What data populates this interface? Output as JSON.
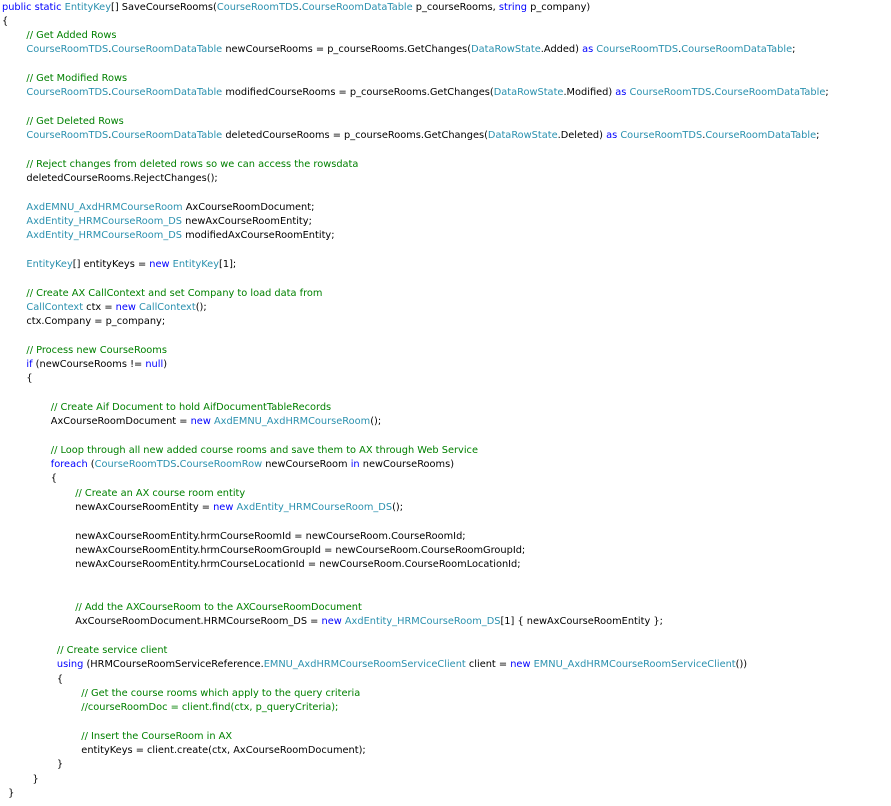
{
  "code_view": {
    "language": "csharp",
    "colors": {
      "keyword": "#0000ff",
      "type": "#2b91af",
      "comment": "#008000",
      "plain": "#000000",
      "background": "#ffffff"
    },
    "lines": [
      {
        "indent": 0,
        "tokens": [
          [
            "kw",
            "public"
          ],
          [
            "p",
            " "
          ],
          [
            "kw",
            "static"
          ],
          [
            "p",
            " "
          ],
          [
            "type",
            "EntityKey"
          ],
          [
            "p",
            "[] SaveCourseRooms("
          ],
          [
            "type",
            "CourseRoomTDS"
          ],
          [
            "p",
            "."
          ],
          [
            "type",
            "CourseRoomDataTable"
          ],
          [
            "p",
            " p_courseRooms, "
          ],
          [
            "kw",
            "string"
          ],
          [
            "p",
            " p_company)"
          ]
        ]
      },
      {
        "indent": 0,
        "tokens": [
          [
            "p",
            "{"
          ]
        ]
      },
      {
        "indent": 4,
        "tokens": [
          [
            "c",
            "// Get Added Rows"
          ]
        ]
      },
      {
        "indent": 4,
        "tokens": [
          [
            "type",
            "CourseRoomTDS"
          ],
          [
            "p",
            "."
          ],
          [
            "type",
            "CourseRoomDataTable"
          ],
          [
            "p",
            " newCourseRooms = p_courseRooms.GetChanges("
          ],
          [
            "type",
            "DataRowState"
          ],
          [
            "p",
            ".Added) "
          ],
          [
            "kw",
            "as"
          ],
          [
            "p",
            " "
          ],
          [
            "type",
            "CourseRoomTDS"
          ],
          [
            "p",
            "."
          ],
          [
            "type",
            "CourseRoomDataTable"
          ],
          [
            "p",
            ";"
          ]
        ]
      },
      {
        "indent": 0,
        "tokens": []
      },
      {
        "indent": 4,
        "tokens": [
          [
            "c",
            "// Get Modified Rows"
          ]
        ]
      },
      {
        "indent": 4,
        "tokens": [
          [
            "type",
            "CourseRoomTDS"
          ],
          [
            "p",
            "."
          ],
          [
            "type",
            "CourseRoomDataTable"
          ],
          [
            "p",
            " modifiedCourseRooms = p_courseRooms.GetChanges("
          ],
          [
            "type",
            "DataRowState"
          ],
          [
            "p",
            ".Modified) "
          ],
          [
            "kw",
            "as"
          ],
          [
            "p",
            " "
          ],
          [
            "type",
            "CourseRoomTDS"
          ],
          [
            "p",
            "."
          ],
          [
            "type",
            "CourseRoomDataTable"
          ],
          [
            "p",
            ";"
          ]
        ]
      },
      {
        "indent": 0,
        "tokens": []
      },
      {
        "indent": 4,
        "tokens": [
          [
            "c",
            "// Get Deleted Rows"
          ]
        ]
      },
      {
        "indent": 4,
        "tokens": [
          [
            "type",
            "CourseRoomTDS"
          ],
          [
            "p",
            "."
          ],
          [
            "type",
            "CourseRoomDataTable"
          ],
          [
            "p",
            " deletedCourseRooms = p_courseRooms.GetChanges("
          ],
          [
            "type",
            "DataRowState"
          ],
          [
            "p",
            ".Deleted) "
          ],
          [
            "kw",
            "as"
          ],
          [
            "p",
            " "
          ],
          [
            "type",
            "CourseRoomTDS"
          ],
          [
            "p",
            "."
          ],
          [
            "type",
            "CourseRoomDataTable"
          ],
          [
            "p",
            ";"
          ]
        ]
      },
      {
        "indent": 0,
        "tokens": []
      },
      {
        "indent": 4,
        "tokens": [
          [
            "c",
            "// Reject changes from deleted rows so we can access the rowsdata"
          ]
        ]
      },
      {
        "indent": 4,
        "tokens": [
          [
            "p",
            "deletedCourseRooms.RejectChanges();"
          ]
        ]
      },
      {
        "indent": 0,
        "tokens": []
      },
      {
        "indent": 4,
        "tokens": [
          [
            "type",
            "AxdEMNU_AxdHRMCourseRoom"
          ],
          [
            "p",
            " AxCourseRoomDocument;"
          ]
        ]
      },
      {
        "indent": 4,
        "tokens": [
          [
            "type",
            "AxdEntity_HRMCourseRoom_DS"
          ],
          [
            "p",
            " newAxCourseRoomEntity;"
          ]
        ]
      },
      {
        "indent": 4,
        "tokens": [
          [
            "type",
            "AxdEntity_HRMCourseRoom_DS"
          ],
          [
            "p",
            " modifiedAxCourseRoomEntity;"
          ]
        ]
      },
      {
        "indent": 0,
        "tokens": []
      },
      {
        "indent": 4,
        "tokens": [
          [
            "type",
            "EntityKey"
          ],
          [
            "p",
            "[] entityKeys = "
          ],
          [
            "kw",
            "new"
          ],
          [
            "p",
            " "
          ],
          [
            "type",
            "EntityKey"
          ],
          [
            "p",
            "[1];"
          ]
        ]
      },
      {
        "indent": 0,
        "tokens": []
      },
      {
        "indent": 4,
        "tokens": [
          [
            "c",
            "// Create AX CallContext and set Company to load data from"
          ]
        ]
      },
      {
        "indent": 4,
        "tokens": [
          [
            "type",
            "CallContext"
          ],
          [
            "p",
            " ctx = "
          ],
          [
            "kw",
            "new"
          ],
          [
            "p",
            " "
          ],
          [
            "type",
            "CallContext"
          ],
          [
            "p",
            "();"
          ]
        ]
      },
      {
        "indent": 4,
        "tokens": [
          [
            "p",
            "ctx.Company = p_company;"
          ]
        ]
      },
      {
        "indent": 0,
        "tokens": []
      },
      {
        "indent": 4,
        "tokens": [
          [
            "c",
            "// Process new CourseRooms"
          ]
        ]
      },
      {
        "indent": 4,
        "tokens": [
          [
            "kw",
            "if"
          ],
          [
            "p",
            " (newCourseRooms != "
          ],
          [
            "kw",
            "null"
          ],
          [
            "p",
            ")"
          ]
        ]
      },
      {
        "indent": 4,
        "tokens": [
          [
            "p",
            "{"
          ]
        ]
      },
      {
        "indent": 0,
        "tokens": []
      },
      {
        "indent": 8,
        "tokens": [
          [
            "c",
            "// Create Aif Document to hold AifDocumentTableRecords"
          ]
        ]
      },
      {
        "indent": 8,
        "tokens": [
          [
            "p",
            "AxCourseRoomDocument = "
          ],
          [
            "kw",
            "new"
          ],
          [
            "p",
            " "
          ],
          [
            "type",
            "AxdEMNU_AxdHRMCourseRoom"
          ],
          [
            "p",
            "();"
          ]
        ]
      },
      {
        "indent": 0,
        "tokens": []
      },
      {
        "indent": 8,
        "tokens": [
          [
            "c",
            "// Loop through all new added course rooms and save them to AX through Web Service"
          ]
        ]
      },
      {
        "indent": 8,
        "tokens": [
          [
            "kw",
            "foreach"
          ],
          [
            "p",
            " ("
          ],
          [
            "type",
            "CourseRoomTDS"
          ],
          [
            "p",
            "."
          ],
          [
            "type",
            "CourseRoomRow"
          ],
          [
            "p",
            " newCourseRoom "
          ],
          [
            "kw",
            "in"
          ],
          [
            "p",
            " newCourseRooms)"
          ]
        ]
      },
      {
        "indent": 8,
        "tokens": [
          [
            "p",
            "{"
          ]
        ]
      },
      {
        "indent": 12,
        "tokens": [
          [
            "c",
            "// Create an AX course room entity"
          ]
        ]
      },
      {
        "indent": 12,
        "tokens": [
          [
            "p",
            "newAxCourseRoomEntity = "
          ],
          [
            "kw",
            "new"
          ],
          [
            "p",
            " "
          ],
          [
            "type",
            "AxdEntity_HRMCourseRoom_DS"
          ],
          [
            "p",
            "();"
          ]
        ]
      },
      {
        "indent": 0,
        "tokens": []
      },
      {
        "indent": 12,
        "tokens": [
          [
            "p",
            "newAxCourseRoomEntity.hrmCourseRoomId = newCourseRoom.CourseRoomId;"
          ]
        ]
      },
      {
        "indent": 12,
        "tokens": [
          [
            "p",
            "newAxCourseRoomEntity.hrmCourseRoomGroupId = newCourseRoom.CourseRoomGroupId;"
          ]
        ]
      },
      {
        "indent": 12,
        "tokens": [
          [
            "p",
            "newAxCourseRoomEntity.hrmCourseLocationId = newCourseRoom.CourseRoomLocationId;"
          ]
        ]
      },
      {
        "indent": 0,
        "tokens": []
      },
      {
        "indent": 0,
        "tokens": []
      },
      {
        "indent": 12,
        "tokens": [
          [
            "c",
            "// Add the AXCourseRoom to the AXCourseRoomDocument"
          ]
        ]
      },
      {
        "indent": 12,
        "tokens": [
          [
            "p",
            "AxCourseRoomDocument.HRMCourseRoom_DS = "
          ],
          [
            "kw",
            "new"
          ],
          [
            "p",
            " "
          ],
          [
            "type",
            "AxdEntity_HRMCourseRoom_DS"
          ],
          [
            "p",
            "[1] { newAxCourseRoomEntity };"
          ]
        ]
      },
      {
        "indent": 0,
        "tokens": []
      },
      {
        "indent": 9,
        "tokens": [
          [
            "c",
            "// Create service client"
          ]
        ]
      },
      {
        "indent": 9,
        "tokens": [
          [
            "kw",
            "using"
          ],
          [
            "p",
            " (HRMCourseRoomServiceReference."
          ],
          [
            "type",
            "EMNU_AxdHRMCourseRoomServiceClient"
          ],
          [
            "p",
            " client = "
          ],
          [
            "kw",
            "new"
          ],
          [
            "p",
            " "
          ],
          [
            "type",
            "EMNU_AxdHRMCourseRoomServiceClient"
          ],
          [
            "p",
            "())"
          ]
        ]
      },
      {
        "indent": 9,
        "tokens": [
          [
            "p",
            "{"
          ]
        ]
      },
      {
        "indent": 13,
        "tokens": [
          [
            "c",
            "// Get the course rooms which apply to the query criteria"
          ]
        ]
      },
      {
        "indent": 13,
        "tokens": [
          [
            "c",
            "//courseRoomDoc = client.find(ctx, p_queryCriteria);"
          ]
        ]
      },
      {
        "indent": 0,
        "tokens": []
      },
      {
        "indent": 13,
        "tokens": [
          [
            "c",
            "// Insert the CourseRoom in AX"
          ]
        ]
      },
      {
        "indent": 13,
        "tokens": [
          [
            "p",
            "entityKeys = client.create(ctx, AxCourseRoomDocument);"
          ]
        ]
      },
      {
        "indent": 9,
        "tokens": [
          [
            "p",
            "}"
          ]
        ]
      },
      {
        "indent": 5,
        "tokens": [
          [
            "p",
            "}"
          ]
        ]
      },
      {
        "indent": 1,
        "tokens": [
          [
            "p",
            "}"
          ]
        ]
      }
    ]
  }
}
